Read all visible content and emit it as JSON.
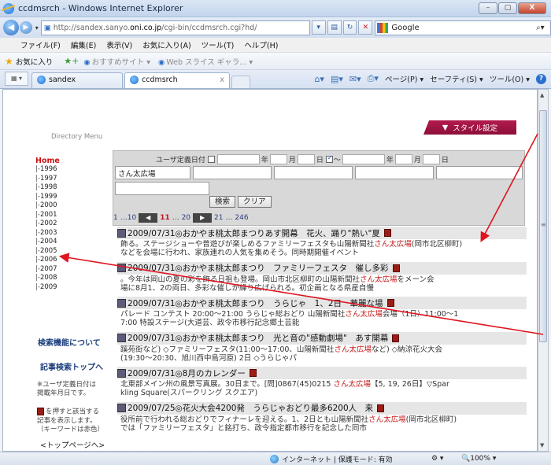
{
  "window": {
    "title": "ccdmsrch - Windows Internet Explorer",
    "minimize": "–",
    "restore": "▢",
    "close": "X"
  },
  "navbar": {
    "url_prefix": "http://sandex.sanyo.",
    "url_domain": "oni.co.jp",
    "url_suffix": "/cgi-bin/ccdmsrch.cgi?hd/",
    "search_engine": "Google"
  },
  "menubar": [
    "ファイル(F)",
    "編集(E)",
    "表示(V)",
    "お気に入り(A)",
    "ツール(T)",
    "ヘルプ(H)"
  ],
  "favbar": {
    "favorites": "お気に入り",
    "suggested": "おすすめサイト",
    "webslice": "Web スライス ギャラ..."
  },
  "tabs": [
    {
      "label": "sandex"
    },
    {
      "label": "ccdmsrch",
      "close": "x"
    }
  ],
  "commandbar": {
    "page": "ページ(P)",
    "safety": "セーフティ(S)",
    "tools": "ツール(O)"
  },
  "style_button": "スタイル設定",
  "sidebar": {
    "directory_menu": "Directory Menu",
    "home": "Home",
    "years": [
      "1996",
      "1997",
      "1998",
      "1999",
      "2000",
      "2001",
      "2002",
      "2003",
      "2004",
      "2005",
      "2006",
      "2007",
      "2008",
      "2009"
    ],
    "about_search": "検索機能について",
    "search_top": "記事検索トップへ",
    "note_line1": "※ユーザ定義日付は",
    "note_line2": "掲載年月日です。",
    "icon_note_line1": "を押すと該当する",
    "icon_note_line2": "記事を表示します。",
    "icon_note_line3": "（キーワードは赤色）",
    "to_top": "<トップページへ>"
  },
  "form": {
    "user_date_label": "ユーザ定義日付",
    "year": "年",
    "month": "月",
    "day_tilde": "日",
    "tilde": "〜",
    "day": "日",
    "keyword": "さん太広場",
    "search_button": "検索",
    "clear_button": "クリア",
    "pager": {
      "first": "1",
      "ellipsis1": "…10",
      "prev_page": "11",
      "ellipsis2": "… 20",
      "next_page": "21",
      "last": "… 246"
    }
  },
  "results": [
    {
      "title": "2009/07/31◎おかやま桃太郎まつりあす開幕　花火、踊り\"熱い\"夏",
      "body1_a": "飾る。ステージショーや普遊びが楽しめるファミリーフェスタも山陽新聞社",
      "body1_hl": "さん太広場",
      "body1_b": "(岡市北区柳町)",
      "body2": "などを会場に行われ、家族連れの人気を集めそう。同時期開催イベント"
    },
    {
      "title": "2009/07/31◎おかやま桃太郎まつり　ファミリーフェスタ　催し多彩",
      "body1_a": "。今年は岡山の夏の彩を飾る日祖も登場。岡山市北区柳町の山陽新聞社",
      "body1_hl": "さん太広場",
      "body1_b": "をメーン会",
      "body2": "場に8月1、2の両日、多彩な催しが繰り広げられる。初企画となる県産自慢"
    },
    {
      "title": "2009/07/31◎おかやま桃太郎まつり　うらじゃ　1、2日　華麗な場",
      "body1_a": "パレード コンテスト 20:00〜21:00 うらじゃ総おどり 山陽新聞社",
      "body1_hl": "さん太広場",
      "body1_b": "会場（1日）11:00〜1",
      "body2": "7:00 特設ステージ(大道芸、政令市移行記念郷土芸能"
    },
    {
      "title": "2009/07/31◎おかやま桃太郎まつり　光と音の\"感動劇場\"　あす開幕",
      "body1_a": "蹊苑街など) ◇ファミリーフェスタ(11:00〜17:00、山陽新聞社",
      "body1_hl": "さん太広場",
      "body1_b": "など) ◇納涼花火大会",
      "body2": "(19:30〜20:30、旭川西中島河原) 2日 ◇うらじゃパ"
    },
    {
      "title": "2009/07/31◎8月のカレンダー",
      "body1_a": "北東部メイン州の風景写真展。30日まで。[問]0867(45)0215 ",
      "body1_hl": "さん太広場",
      "body1_b": "【5, 19, 26日】▽Spar",
      "body2": "kling Square(スパークリング スクエア)"
    },
    {
      "title": "2009/07/25◎花火大会4200発　うらじゃおどり最多6200人　来",
      "body1_a": "役所前で行われる総おどりでフィナーレを迎える。1、2日とも山陽新聞社",
      "body1_hl": "さん太広場",
      "body1_b": "(岡市北区柳町)",
      "body2": "では「ファミリーフェスタ」と銘打ち、政令指定都市移行を記念した同市"
    }
  ],
  "statusbar": {
    "zone": "インターネット | 保護モード: 有効",
    "zoom": "100%"
  },
  "colors": {
    "accent": "#a3163f",
    "highlight": "#c31a1a",
    "annotation_arrow": "#e0141e"
  }
}
